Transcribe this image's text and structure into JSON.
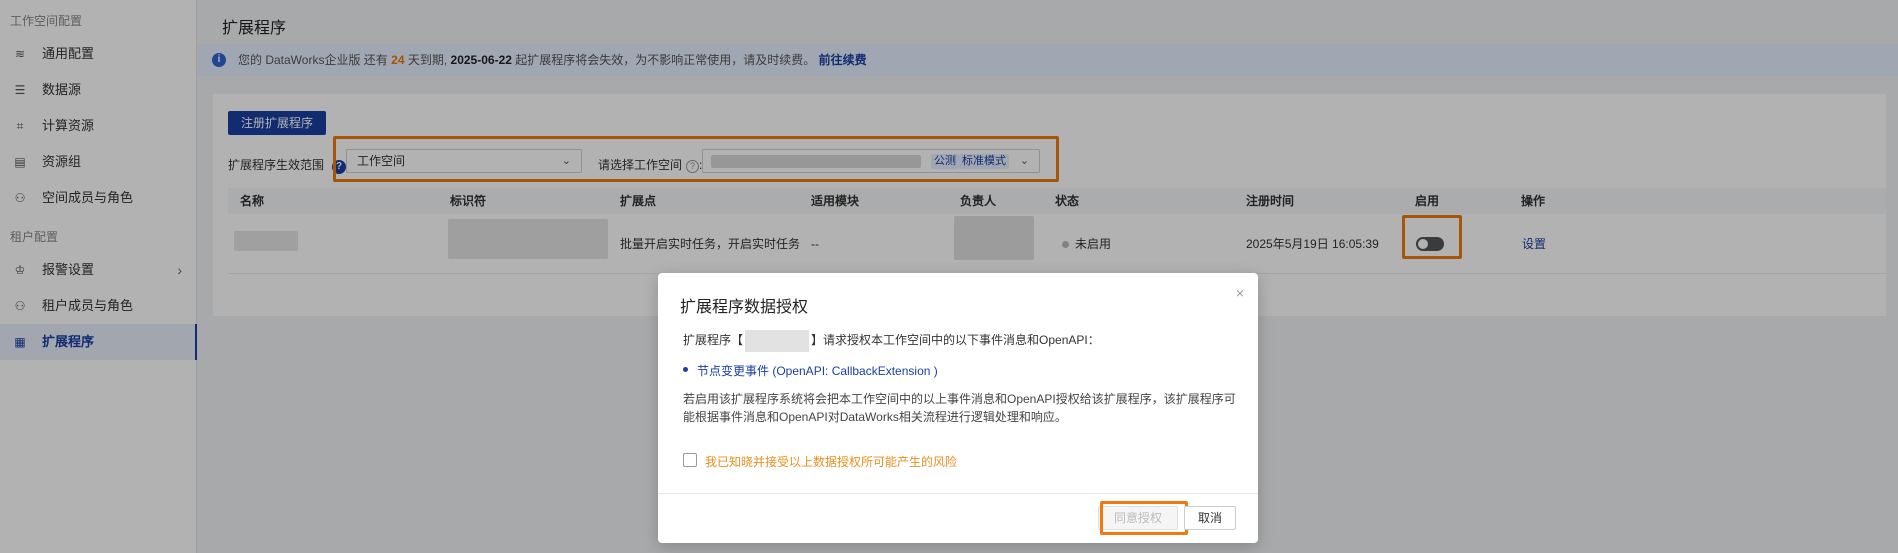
{
  "sidebar": {
    "group_workspace": "工作空间配置",
    "items_workspace": [
      {
        "label": "通用配置",
        "icon": "layers-icon"
      },
      {
        "label": "数据源",
        "icon": "database-icon"
      },
      {
        "label": "计算资源",
        "icon": "compute-icon"
      },
      {
        "label": "资源组",
        "icon": "server-icon"
      },
      {
        "label": "空间成员与角色",
        "icon": "user-icon"
      }
    ],
    "group_tenant": "租户配置",
    "items_tenant": [
      {
        "label": "报警设置",
        "icon": "alarm-icon"
      },
      {
        "label": "租户成员与角色",
        "icon": "user-icon"
      },
      {
        "label": "扩展程序",
        "icon": "grid-icon",
        "active": true
      }
    ]
  },
  "header": {
    "title": "扩展程序"
  },
  "notice": {
    "prefix": "您的 DataWorks企业版 还有",
    "days": "24",
    "days_suffix": "天到期,",
    "date": "2025-06-22",
    "message": "起扩展程序将会失效，为不影响正常使用，请及时续费。",
    "renew_link": "前往续费"
  },
  "toolbar": {
    "register_button": "注册扩展程序",
    "scope_label": "扩展程序生效范围",
    "scope_value": "工作空间",
    "workspace_label": "请选择工作空间",
    "tag_public": "公测",
    "tag_mode": "标准模式"
  },
  "table": {
    "columns": [
      "名称",
      "标识符",
      "扩展点",
      "适用模块",
      "负责人",
      "状态",
      "注册时间",
      "启用",
      "操作"
    ],
    "rows": [
      {
        "extension_point": "批量开启实时任务，开启实时任务",
        "module": "--",
        "status": "未启用",
        "registered": "2025年5月19日 16:05:39",
        "action": "设置"
      }
    ]
  },
  "modal": {
    "title": "扩展程序数据授权",
    "close": "×",
    "request_prefix": "扩展程序【",
    "request_suffix": "】请求授权本工作空间中的以下事件消息和OpenAPI：",
    "event": "节点变更事件 (OpenAPI: CallbackExtension )",
    "description": "若启用该扩展程序系统将会把本工作空间中的以上事件消息和OpenAPI授权给该扩展程序，该扩展程序可能根据事件消息和OpenAPI对DataWorks相关流程进行逻辑处理和响应。",
    "checkbox_label": "我已知晓并接受以上数据授权所可能产生的风险",
    "agree_button": "同意授权",
    "cancel_button": "取消"
  },
  "colors": {
    "accent": "#1a3fa3",
    "highlight": "#f07a10",
    "warning_text": "#e8901e"
  }
}
